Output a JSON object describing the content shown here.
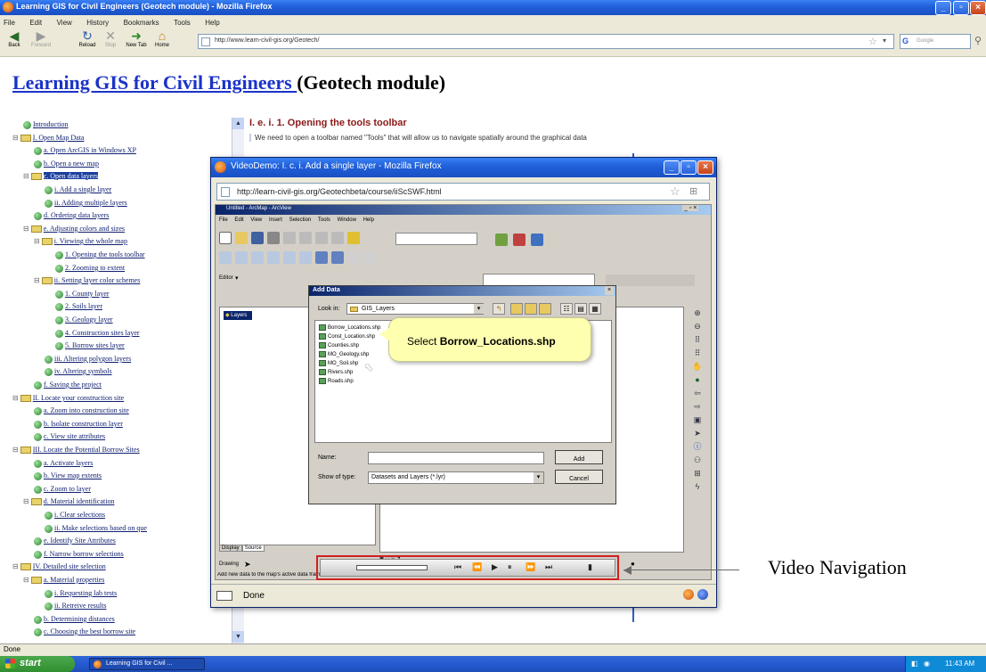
{
  "browser": {
    "title": "Learning GIS for Civil Engineers (Geotech module) - Mozilla Firefox",
    "menu": [
      "File",
      "Edit",
      "View",
      "History",
      "Bookmarks",
      "Tools",
      "Help"
    ],
    "nav": {
      "back": "Back",
      "forward": "Forward",
      "reload": "Reload",
      "stop": "Stop",
      "new_tab": "New Tab",
      "home": "Home"
    },
    "url": "http://www.learn-civil-gis.org/Geotech/",
    "search_placeholder": "Google",
    "status": "Done"
  },
  "page": {
    "title_link": "Learning GIS for Civil Engineers ",
    "title_rest": "(Geotech module)",
    "section_heading": "I. e. i. 1. Opening the tools toolbar",
    "section_text": "We need to open a toolbar named \"Tools\" that will allow us to navigate spatially around the graphical data"
  },
  "tree": [
    "Introduction",
    "I. Open Map Data",
    "a. Open ArcGIS in Windows XP",
    "b. Open a new map",
    "c. Open data layers",
    "i. Add a single layer",
    "ii. Adding multiple layers",
    "d. Ordering data layers",
    "e. Adjusting colors and sizes",
    "i. Viewing the whole map",
    "1. Opening the tools toolbar",
    "2. Zooming to extent",
    "ii. Setting layer color schemes",
    "1. County layer",
    "2. Soils layer",
    "3. Geology layer",
    "4. Construction sites layer",
    "5. Borrow sites layer",
    "iii. Altering polygon layers",
    "iv. Altering symbols",
    "f. Saving the project",
    "II. Locate your construction site",
    "a. Zoom into construction site",
    "b. Isolate construction layer",
    "c. View site attributes",
    "III. Locate the Potential Borrow Sites",
    "a. Activate layers",
    "b. View map extents",
    "c. Zoom to layer",
    "d. Material identification",
    "i. Clear selections",
    "ii. Make selections based on que",
    "e. Identify Site Attributes",
    "f. Narrow borrow selections",
    "IV. Detailed site selection",
    "a. Material properties",
    "i. Requesting lab tests",
    "ii. Retreive results",
    "b. Determining distances",
    "c. Choosing the best borrow site"
  ],
  "video_window": {
    "title": "VideoDemo: I. c. i. Add a single layer - Mozilla Firefox",
    "url": "http://learn-civil-gis.org/Geotechbeta/course/iiScSWF.html",
    "status": "Done",
    "arcmap_title": "Untitled - ArcMap - ArcView",
    "arcmap_menu": [
      "File",
      "Edit",
      "View",
      "Insert",
      "Selection",
      "Tools",
      "Window",
      "Help"
    ],
    "toc_layers": "Layers",
    "toc_tabs": [
      "Display",
      "Source"
    ],
    "editor": "Editor",
    "drawing": "Drawing",
    "font": "Arial",
    "status_text": "Add new data to the map's active data frame"
  },
  "add_data_dialog": {
    "title": "Add Data",
    "look_in_label": "Look in:",
    "look_in_value": "GIS_Layers",
    "files": [
      "Borrow_Locations.shp",
      "Const_Location.shp",
      "Counties.shp",
      "MO_Geology.shp",
      "MO_Soil.shp",
      "Rivers.shp",
      "Roads.shp"
    ],
    "name_label": "Name:",
    "type_label": "Show of type:",
    "type_value": "Datasets and Layers (*.lyr)",
    "add_button": "Add",
    "cancel_button": "Cancel"
  },
  "callout": {
    "prefix": "Select ",
    "bold": "Borrow_Locations.shp"
  },
  "annotation": {
    "label": "Video Navigation"
  },
  "taskbar": {
    "start": "start",
    "task": "Learning GIS for Civil ...",
    "clock": "11:43 AM"
  },
  "colors": {
    "xp_blue": "#1f5fd8",
    "link_blue": "#1a33c8",
    "highlight_red": "#d02020"
  }
}
